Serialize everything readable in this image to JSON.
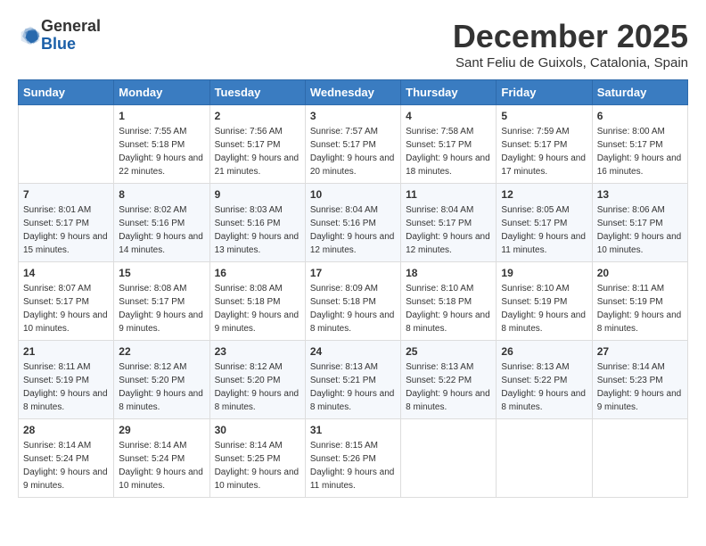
{
  "logo": {
    "general": "General",
    "blue": "Blue"
  },
  "header": {
    "month_title": "December 2025",
    "location": "Sant Feliu de Guixols, Catalonia, Spain"
  },
  "weekdays": [
    "Sunday",
    "Monday",
    "Tuesday",
    "Wednesday",
    "Thursday",
    "Friday",
    "Saturday"
  ],
  "weeks": [
    [
      {
        "day": "",
        "sunrise": "",
        "sunset": "",
        "daylight": ""
      },
      {
        "day": "1",
        "sunrise": "Sunrise: 7:55 AM",
        "sunset": "Sunset: 5:18 PM",
        "daylight": "Daylight: 9 hours and 22 minutes."
      },
      {
        "day": "2",
        "sunrise": "Sunrise: 7:56 AM",
        "sunset": "Sunset: 5:17 PM",
        "daylight": "Daylight: 9 hours and 21 minutes."
      },
      {
        "day": "3",
        "sunrise": "Sunrise: 7:57 AM",
        "sunset": "Sunset: 5:17 PM",
        "daylight": "Daylight: 9 hours and 20 minutes."
      },
      {
        "day": "4",
        "sunrise": "Sunrise: 7:58 AM",
        "sunset": "Sunset: 5:17 PM",
        "daylight": "Daylight: 9 hours and 18 minutes."
      },
      {
        "day": "5",
        "sunrise": "Sunrise: 7:59 AM",
        "sunset": "Sunset: 5:17 PM",
        "daylight": "Daylight: 9 hours and 17 minutes."
      },
      {
        "day": "6",
        "sunrise": "Sunrise: 8:00 AM",
        "sunset": "Sunset: 5:17 PM",
        "daylight": "Daylight: 9 hours and 16 minutes."
      }
    ],
    [
      {
        "day": "7",
        "sunrise": "Sunrise: 8:01 AM",
        "sunset": "Sunset: 5:17 PM",
        "daylight": "Daylight: 9 hours and 15 minutes."
      },
      {
        "day": "8",
        "sunrise": "Sunrise: 8:02 AM",
        "sunset": "Sunset: 5:16 PM",
        "daylight": "Daylight: 9 hours and 14 minutes."
      },
      {
        "day": "9",
        "sunrise": "Sunrise: 8:03 AM",
        "sunset": "Sunset: 5:16 PM",
        "daylight": "Daylight: 9 hours and 13 minutes."
      },
      {
        "day": "10",
        "sunrise": "Sunrise: 8:04 AM",
        "sunset": "Sunset: 5:16 PM",
        "daylight": "Daylight: 9 hours and 12 minutes."
      },
      {
        "day": "11",
        "sunrise": "Sunrise: 8:04 AM",
        "sunset": "Sunset: 5:17 PM",
        "daylight": "Daylight: 9 hours and 12 minutes."
      },
      {
        "day": "12",
        "sunrise": "Sunrise: 8:05 AM",
        "sunset": "Sunset: 5:17 PM",
        "daylight": "Daylight: 9 hours and 11 minutes."
      },
      {
        "day": "13",
        "sunrise": "Sunrise: 8:06 AM",
        "sunset": "Sunset: 5:17 PM",
        "daylight": "Daylight: 9 hours and 10 minutes."
      }
    ],
    [
      {
        "day": "14",
        "sunrise": "Sunrise: 8:07 AM",
        "sunset": "Sunset: 5:17 PM",
        "daylight": "Daylight: 9 hours and 10 minutes."
      },
      {
        "day": "15",
        "sunrise": "Sunrise: 8:08 AM",
        "sunset": "Sunset: 5:17 PM",
        "daylight": "Daylight: 9 hours and 9 minutes."
      },
      {
        "day": "16",
        "sunrise": "Sunrise: 8:08 AM",
        "sunset": "Sunset: 5:18 PM",
        "daylight": "Daylight: 9 hours and 9 minutes."
      },
      {
        "day": "17",
        "sunrise": "Sunrise: 8:09 AM",
        "sunset": "Sunset: 5:18 PM",
        "daylight": "Daylight: 9 hours and 8 minutes."
      },
      {
        "day": "18",
        "sunrise": "Sunrise: 8:10 AM",
        "sunset": "Sunset: 5:18 PM",
        "daylight": "Daylight: 9 hours and 8 minutes."
      },
      {
        "day": "19",
        "sunrise": "Sunrise: 8:10 AM",
        "sunset": "Sunset: 5:19 PM",
        "daylight": "Daylight: 9 hours and 8 minutes."
      },
      {
        "day": "20",
        "sunrise": "Sunrise: 8:11 AM",
        "sunset": "Sunset: 5:19 PM",
        "daylight": "Daylight: 9 hours and 8 minutes."
      }
    ],
    [
      {
        "day": "21",
        "sunrise": "Sunrise: 8:11 AM",
        "sunset": "Sunset: 5:19 PM",
        "daylight": "Daylight: 9 hours and 8 minutes."
      },
      {
        "day": "22",
        "sunrise": "Sunrise: 8:12 AM",
        "sunset": "Sunset: 5:20 PM",
        "daylight": "Daylight: 9 hours and 8 minutes."
      },
      {
        "day": "23",
        "sunrise": "Sunrise: 8:12 AM",
        "sunset": "Sunset: 5:20 PM",
        "daylight": "Daylight: 9 hours and 8 minutes."
      },
      {
        "day": "24",
        "sunrise": "Sunrise: 8:13 AM",
        "sunset": "Sunset: 5:21 PM",
        "daylight": "Daylight: 9 hours and 8 minutes."
      },
      {
        "day": "25",
        "sunrise": "Sunrise: 8:13 AM",
        "sunset": "Sunset: 5:22 PM",
        "daylight": "Daylight: 9 hours and 8 minutes."
      },
      {
        "day": "26",
        "sunrise": "Sunrise: 8:13 AM",
        "sunset": "Sunset: 5:22 PM",
        "daylight": "Daylight: 9 hours and 8 minutes."
      },
      {
        "day": "27",
        "sunrise": "Sunrise: 8:14 AM",
        "sunset": "Sunset: 5:23 PM",
        "daylight": "Daylight: 9 hours and 9 minutes."
      }
    ],
    [
      {
        "day": "28",
        "sunrise": "Sunrise: 8:14 AM",
        "sunset": "Sunset: 5:24 PM",
        "daylight": "Daylight: 9 hours and 9 minutes."
      },
      {
        "day": "29",
        "sunrise": "Sunrise: 8:14 AM",
        "sunset": "Sunset: 5:24 PM",
        "daylight": "Daylight: 9 hours and 10 minutes."
      },
      {
        "day": "30",
        "sunrise": "Sunrise: 8:14 AM",
        "sunset": "Sunset: 5:25 PM",
        "daylight": "Daylight: 9 hours and 10 minutes."
      },
      {
        "day": "31",
        "sunrise": "Sunrise: 8:15 AM",
        "sunset": "Sunset: 5:26 PM",
        "daylight": "Daylight: 9 hours and 11 minutes."
      },
      {
        "day": "",
        "sunrise": "",
        "sunset": "",
        "daylight": ""
      },
      {
        "day": "",
        "sunrise": "",
        "sunset": "",
        "daylight": ""
      },
      {
        "day": "",
        "sunrise": "",
        "sunset": "",
        "daylight": ""
      }
    ]
  ]
}
